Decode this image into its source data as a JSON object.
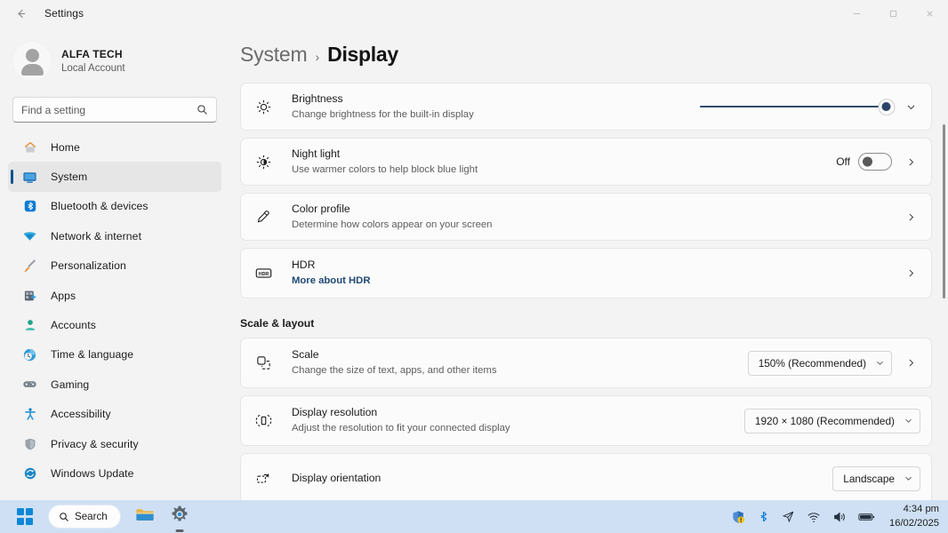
{
  "titlebar": {
    "back_icon": "back-arrow-icon",
    "title": "Settings",
    "minimize_label": "Minimize",
    "maximize_label": "Restore",
    "close_label": "Close"
  },
  "sidebar": {
    "account": {
      "name": "ALFA TECH",
      "subtitle": "Local Account",
      "avatar_icon": "person-avatar-icon"
    },
    "search": {
      "placeholder": "Find a setting",
      "value": "",
      "icon": "search-icon"
    },
    "items": [
      {
        "label": "Home",
        "icon": "home-icon",
        "selected": false
      },
      {
        "label": "System",
        "icon": "monitor-icon",
        "selected": true
      },
      {
        "label": "Bluetooth & devices",
        "icon": "bluetooth-icon",
        "selected": false
      },
      {
        "label": "Network & internet",
        "icon": "wifi-icon",
        "selected": false
      },
      {
        "label": "Personalization",
        "icon": "paintbrush-icon",
        "selected": false
      },
      {
        "label": "Apps",
        "icon": "apps-icon",
        "selected": false
      },
      {
        "label": "Accounts",
        "icon": "account-person-icon",
        "selected": false
      },
      {
        "label": "Time & language",
        "icon": "clock-globe-icon",
        "selected": false
      },
      {
        "label": "Gaming",
        "icon": "gamepad-icon",
        "selected": false
      },
      {
        "label": "Accessibility",
        "icon": "accessibility-icon",
        "selected": false
      },
      {
        "label": "Privacy & security",
        "icon": "shield-icon",
        "selected": false
      },
      {
        "label": "Windows Update",
        "icon": "update-icon",
        "selected": false
      }
    ],
    "selection_accent": "#00538f"
  },
  "breadcrumb": {
    "root": "System",
    "separator": "›",
    "leaf": "Display"
  },
  "display_settings": {
    "cards": [
      {
        "title": "Brightness",
        "subtitle": "Change brightness for the built-in display",
        "icon": "brightness-sun-icon",
        "control": "slider",
        "slider_percent": 97,
        "expand_icon": "chevron-down-icon"
      },
      {
        "title": "Night light",
        "subtitle": "Use warmer colors to help block blue light",
        "icon": "night-light-icon",
        "control": "toggle",
        "toggle_label": "Off",
        "toggle_on": false,
        "chevron_icon": "chevron-right-icon"
      },
      {
        "title": "Color profile",
        "subtitle": "Determine how colors appear on your screen",
        "icon": "eyedropper-icon",
        "control": "chevron",
        "chevron_icon": "chevron-right-icon"
      },
      {
        "title": "HDR",
        "subtitle": "More about HDR",
        "subtitle_is_link": true,
        "icon": "hdr-badge-icon",
        "control": "chevron",
        "chevron_icon": "chevron-right-icon"
      }
    ]
  },
  "scale_layout": {
    "section_title": "Scale & layout",
    "cards": [
      {
        "title": "Scale",
        "subtitle": "Change the size of text, apps, and other items",
        "icon": "scale-icon",
        "control": "combo",
        "value": "150% (Recommended)",
        "combo_icon": "chevron-down-icon",
        "has_chevron": true,
        "chevron_icon": "chevron-right-icon"
      },
      {
        "title": "Display resolution",
        "subtitle": "Adjust the resolution to fit your connected display",
        "icon": "resolution-icon",
        "control": "combo",
        "value": "1920 × 1080 (Recommended)",
        "combo_icon": "chevron-down-icon",
        "has_chevron": false
      },
      {
        "title": "Display orientation",
        "subtitle": "",
        "icon": "orientation-icon",
        "control": "combo",
        "value": "Landscape",
        "combo_icon": "chevron-down-icon",
        "has_chevron": false
      }
    ]
  },
  "taskbar": {
    "start_label": "Start",
    "start_icon": "windows-start-icon",
    "search": {
      "label": "Search",
      "icon": "search-icon"
    },
    "pinned": [
      {
        "label": "File Explorer",
        "icon": "folder-icon",
        "active": false
      },
      {
        "label": "Settings",
        "icon": "gear-icon",
        "active": true
      }
    ],
    "tray": [
      {
        "label": "Windows Security",
        "icon": "defender-shield-warning-icon"
      },
      {
        "label": "Bluetooth",
        "icon": "bluetooth-icon"
      },
      {
        "label": "Send feedback",
        "icon": "cursor-arrow-icon"
      },
      {
        "label": "Network",
        "icon": "wifi-icon"
      },
      {
        "label": "Volume",
        "icon": "speaker-icon"
      },
      {
        "label": "Battery",
        "icon": "battery-icon"
      }
    ],
    "clock": {
      "time": "4:34 pm",
      "date": "16/02/2025"
    }
  }
}
